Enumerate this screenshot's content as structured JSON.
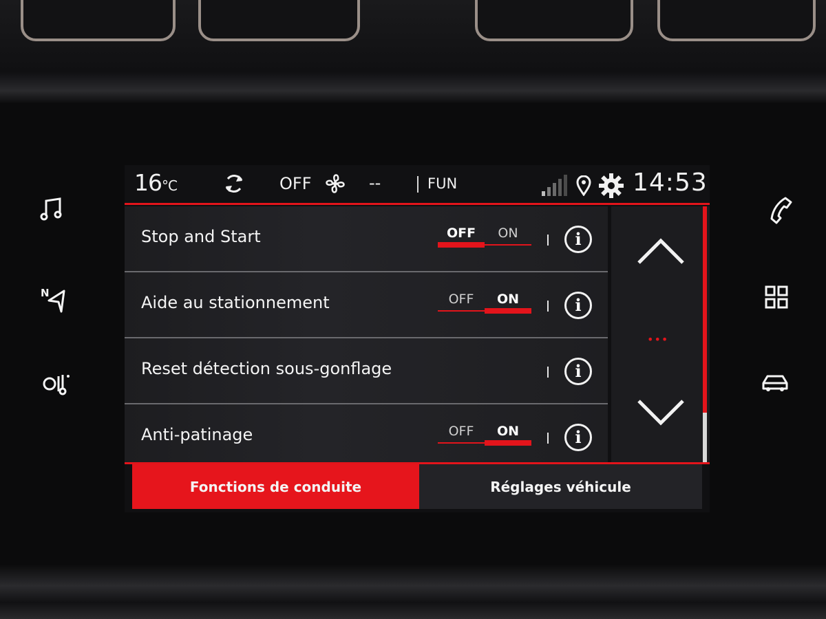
{
  "status_bar": {
    "temperature": "16",
    "temperature_unit": "°C",
    "climate_state": "OFF",
    "fan_level": "--",
    "mode": "FUN",
    "time": "14:53"
  },
  "settings": [
    {
      "label": "Stop and Start",
      "off_label": "OFF",
      "on_label": "ON",
      "state": "OFF"
    },
    {
      "label": "Aide au stationnement",
      "off_label": "OFF",
      "on_label": "ON",
      "state": "ON"
    },
    {
      "label": "Reset détection sous-gonflage"
    },
    {
      "label": "Anti-patinage",
      "off_label": "OFF",
      "on_label": "ON",
      "state": "ON"
    }
  ],
  "info_symbol": "i",
  "scroll": {
    "page_indicator": "•••"
  },
  "tabs": [
    {
      "label": "Fonctions de conduite",
      "active": true
    },
    {
      "label": "Réglages véhicule",
      "active": false
    }
  ],
  "side_keys": {
    "left": [
      "music-icon",
      "navigation-icon",
      "climate-icon"
    ],
    "right": [
      "phone-icon",
      "apps-grid-icon",
      "car-icon"
    ]
  },
  "colors": {
    "accent": "#e3141b",
    "background": "#111113",
    "text": "#f2f2f2"
  }
}
